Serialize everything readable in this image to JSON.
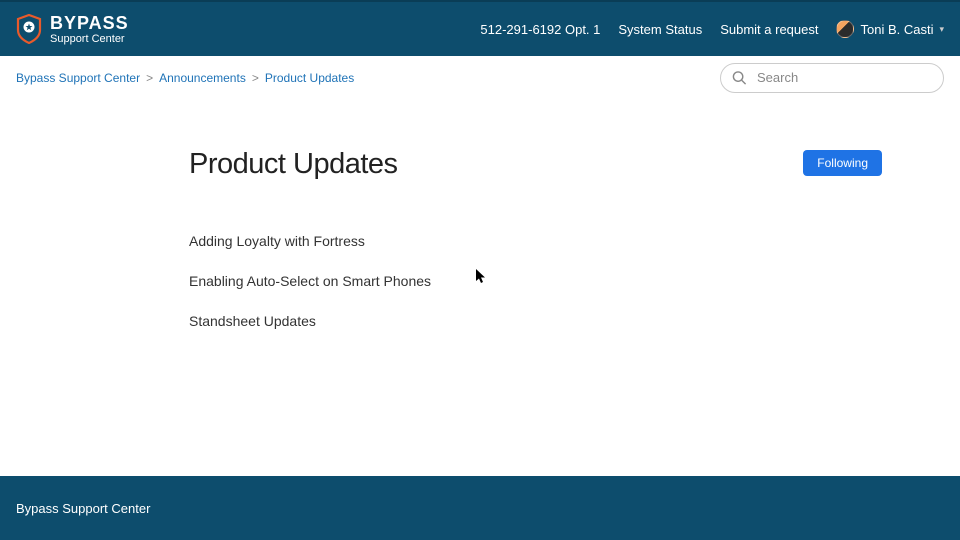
{
  "header": {
    "logo_main": "BYPASS",
    "logo_sub": "Support Center",
    "phone": "512-291-6192 Opt. 1",
    "system_status": "System Status",
    "submit_request": "Submit a request",
    "user_name": "Toni B. Casti"
  },
  "breadcrumb": {
    "items": [
      "Bypass Support Center",
      "Announcements",
      "Product Updates"
    ]
  },
  "search": {
    "placeholder": "Search"
  },
  "page": {
    "title": "Product Updates",
    "follow_label": "Following"
  },
  "articles": [
    "Adding Loyalty with Fortress",
    "Enabling Auto-Select on Smart Phones",
    "Standsheet Updates"
  ],
  "footer": {
    "text": "Bypass Support Center"
  }
}
